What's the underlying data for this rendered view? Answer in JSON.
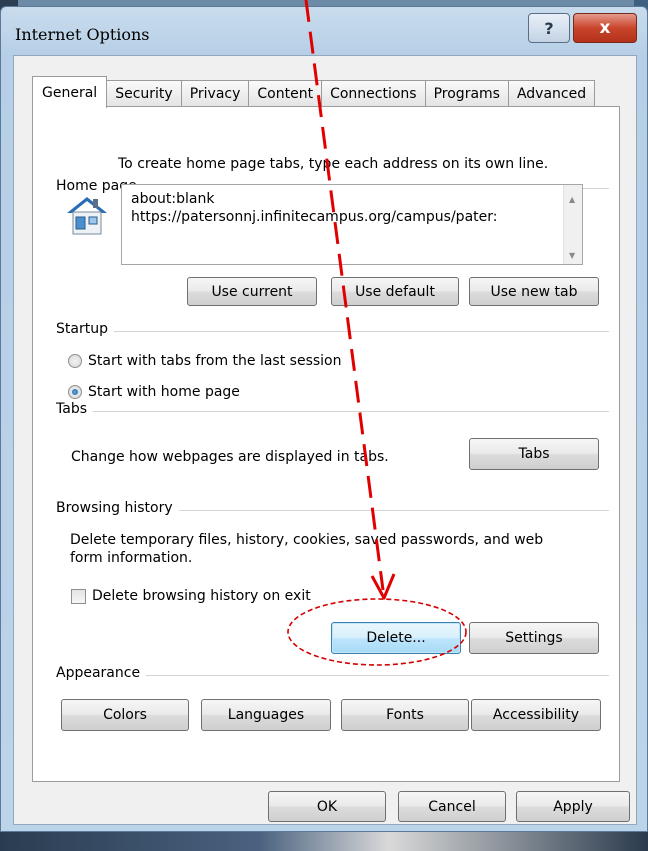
{
  "window": {
    "title": "Internet Options",
    "help_label": "?",
    "close_label": "x"
  },
  "tabs": [
    {
      "label": "General",
      "active": true
    },
    {
      "label": "Security",
      "active": false
    },
    {
      "label": "Privacy",
      "active": false
    },
    {
      "label": "Content",
      "active": false
    },
    {
      "label": "Connections",
      "active": false
    },
    {
      "label": "Programs",
      "active": false
    },
    {
      "label": "Advanced",
      "active": false
    }
  ],
  "home_page": {
    "group_label": "Home page",
    "hint": "To create home page tabs, type each address on its own line.",
    "addresses": [
      "about:blank",
      "https://patersonnj.infinitecampus.org/campus/pater:"
    ],
    "use_current": "Use current",
    "use_default": "Use default",
    "use_new_tab": "Use new tab"
  },
  "startup": {
    "group_label": "Startup",
    "option_last_session": "Start with tabs from the last session",
    "option_home_page": "Start with home page",
    "selected": "home_page"
  },
  "tabs_group": {
    "group_label": "Tabs",
    "description": "Change how webpages are displayed in tabs.",
    "button": "Tabs"
  },
  "browsing_history": {
    "group_label": "Browsing history",
    "description_line1": "Delete temporary files, history, cookies, saved passwords, and web",
    "description_line2": "form information.",
    "delete_on_exit_label": "Delete browsing history on exit",
    "delete_on_exit_checked": false,
    "delete_button": "Delete...",
    "settings_button": "Settings"
  },
  "appearance": {
    "group_label": "Appearance",
    "colors": "Colors",
    "languages": "Languages",
    "fonts": "Fonts",
    "accessibility": "Accessibility"
  },
  "footer": {
    "ok": "OK",
    "cancel": "Cancel",
    "apply": "Apply"
  },
  "annotation": {
    "arrow_color": "#e00000",
    "highlight_color": "#d40000"
  }
}
